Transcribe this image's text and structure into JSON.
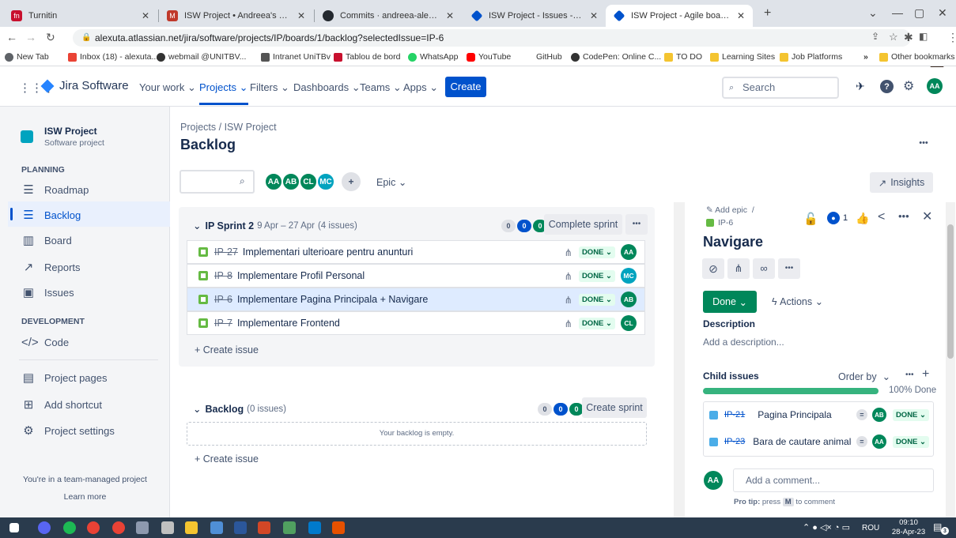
{
  "browser": {
    "tabs": [
      {
        "title": "Turnitin",
        "color": "#c8102e",
        "glyph": "fn"
      },
      {
        "title": "ISW Project • Andreea's Workspa",
        "color": "#c0392b",
        "glyph": "M"
      },
      {
        "title": "Commits · andreea-alexuta/ISW/",
        "color": "#24292f",
        "glyph": "●"
      },
      {
        "title": "ISW Project - Issues - Jira",
        "color": "#0052cc",
        "glyph": "◆"
      },
      {
        "title": "ISW Project - Agile board - Jira",
        "color": "#0052cc",
        "glyph": "◆"
      }
    ],
    "new_tab": "+",
    "url": "alexuta.atlassian.net/jira/software/projects/IP/boards/1/backlog?selectedIssue=IP-6",
    "bookmarks": [
      {
        "label": "New Tab",
        "color": "#5f6368"
      },
      {
        "label": "Inbox (18) - alexuta...",
        "color": "#ea4335"
      },
      {
        "label": "webmail @UNITBV...",
        "color": "#333333"
      },
      {
        "label": "Intranet UniTBv",
        "color": "#555555"
      },
      {
        "label": "Tablou de bord",
        "color": "#c8102e"
      },
      {
        "label": "WhatsApp",
        "color": "#25d366"
      },
      {
        "label": "YouTube",
        "color": "#ff0000"
      },
      {
        "label": "GitHub",
        "color": "#ffffff"
      },
      {
        "label": "CodePen: Online C...",
        "color": "#333333"
      },
      {
        "label": "TO DO",
        "color": "#f4c430"
      },
      {
        "label": "Learning Sites",
        "color": "#f4c430"
      },
      {
        "label": "Job Platforms",
        "color": "#f4c430"
      }
    ],
    "more_bookmarks": "»",
    "other_bookmarks": "Other bookmarks"
  },
  "jira": {
    "logo": "Jira Software",
    "nav": [
      "Your work",
      "Projects",
      "Filters",
      "Dashboards",
      "Teams",
      "Apps"
    ],
    "create": "Create",
    "search_placeholder": "Search",
    "user_initials": "AA"
  },
  "sidebar": {
    "project_name": "ISW Project",
    "project_type": "Software project",
    "planning_heading": "PLANNING",
    "planning_items": [
      {
        "label": "Roadmap",
        "icon": "roadmap-icon"
      },
      {
        "label": "Backlog",
        "icon": "backlog-icon"
      },
      {
        "label": "Board",
        "icon": "board-icon"
      },
      {
        "label": "Reports",
        "icon": "reports-icon"
      },
      {
        "label": "Issues",
        "icon": "issues-icon"
      }
    ],
    "development_heading": "DEVELOPMENT",
    "code": "Code",
    "project_pages": "Project pages",
    "add_shortcut": "Add shortcut",
    "project_settings": "Project settings",
    "footer": "You're in a team-managed project",
    "learn_more": "Learn more"
  },
  "main": {
    "breadcrumb": "Projects  /  ISW Project",
    "title": "Backlog",
    "more": "•••",
    "filter_avatars": [
      {
        "initials": "AA",
        "color": "#00875a"
      },
      {
        "initials": "AB",
        "color": "#00875a"
      },
      {
        "initials": "CL",
        "color": "#00875a"
      },
      {
        "initials": "MC",
        "color": "#00a3bf"
      }
    ],
    "epic_filter": "Epic",
    "insights": "Insights",
    "sprint": {
      "name": "IP Sprint 2",
      "dates": "9 Apr – 27 Apr",
      "count": "(4 issues)",
      "counts": [
        "0",
        "0",
        "0"
      ],
      "complete": "Complete sprint",
      "issues": [
        {
          "key": "IP-27",
          "summary": "Implementari ulterioare pentru anunturi",
          "status": "DONE",
          "assignee": "AA",
          "color": "#00875a"
        },
        {
          "key": "IP-8",
          "summary": "Implementare Profil Personal",
          "status": "DONE",
          "assignee": "MC",
          "color": "#00a3bf"
        },
        {
          "key": "IP-6",
          "summary": "Implementare Pagina Principala + Navigare",
          "status": "DONE",
          "assignee": "AB",
          "color": "#00875a"
        },
        {
          "key": "IP-7",
          "summary": "Implementare Frontend",
          "status": "DONE",
          "assignee": "CL",
          "color": "#00875a"
        }
      ],
      "create_issue": "+ Create issue"
    },
    "backlog": {
      "name": "Backlog",
      "count": "(0 issues)",
      "counts": [
        "0",
        "0",
        "0"
      ],
      "create_sprint": "Create sprint",
      "empty": "Your backlog is empty.",
      "create_issue": "+ Create issue"
    }
  },
  "panel": {
    "add_epic": "Add epic",
    "separator": "/",
    "issue_key": "IP-6",
    "watchers": "1",
    "title": "Navigare",
    "status": "Done",
    "actions": "Actions",
    "description_label": "Description",
    "description_placeholder": "Add a description...",
    "child_issues": "Child issues",
    "order_by": "Order by",
    "progress": 100,
    "progress_label": "100% Done",
    "children": [
      {
        "key": "IP-21",
        "summary": "Pagina Principala",
        "assignee": "AB",
        "status": "DONE"
      },
      {
        "key": "IP-23",
        "summary": "Bara de cautare animale...",
        "assignee": "AA",
        "status": "DONE"
      }
    ],
    "comment_placeholder": "Add a comment...",
    "pro_tip_bold": "Pro tip:",
    "pro_tip_pre": "press",
    "pro_tip_key": "M",
    "pro_tip_post": "to comment"
  },
  "taskbar": {
    "language": "ROU",
    "time": "09:10",
    "date": "28-Apr-23",
    "notifications": "3"
  }
}
